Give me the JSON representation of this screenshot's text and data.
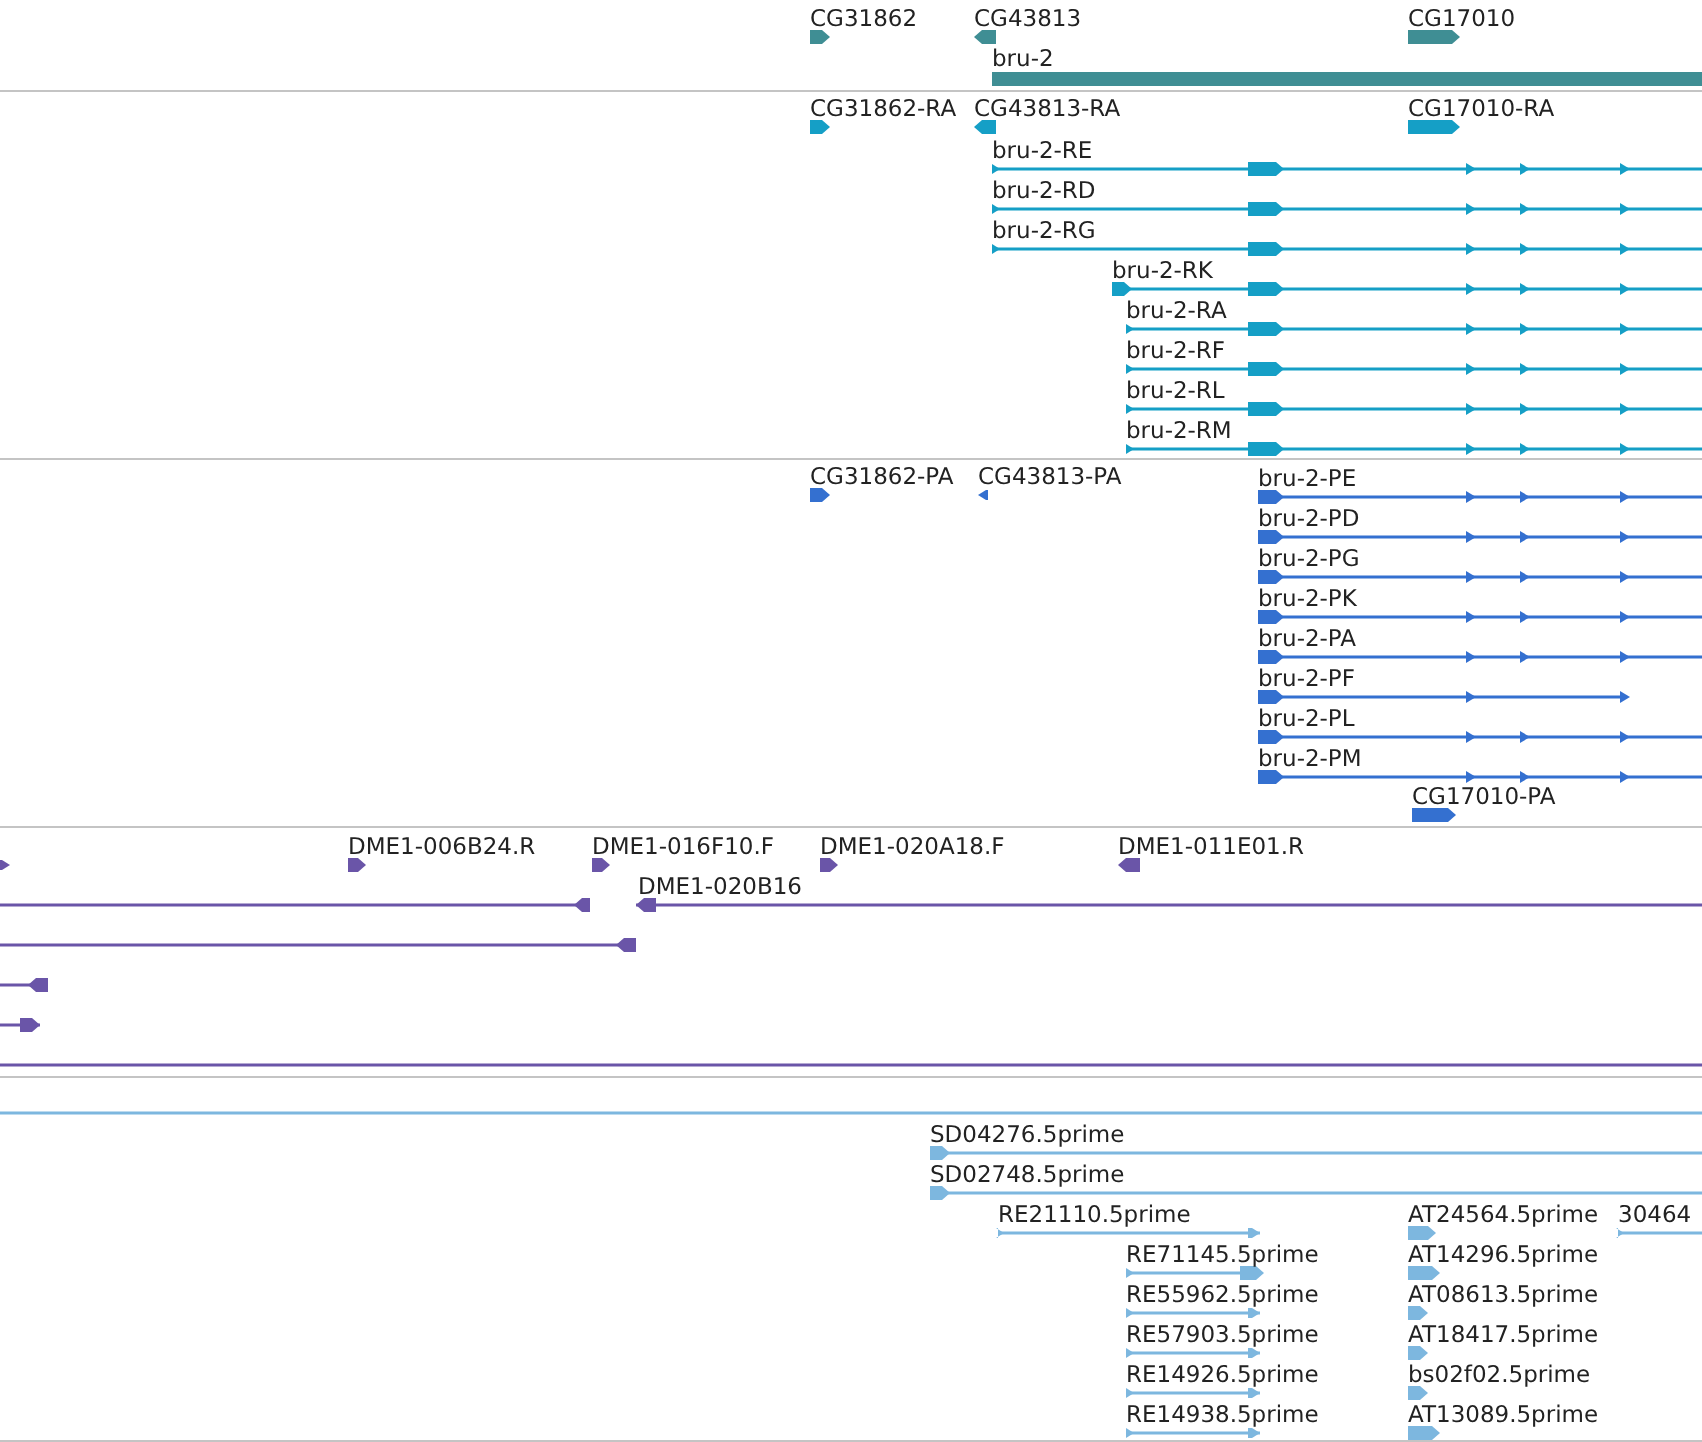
{
  "tracks": [
    {
      "color": "#3f8e94",
      "features": [
        {
          "label": "CG31862",
          "reverse": false
        },
        {
          "label": "CG43813",
          "reverse": true
        },
        {
          "label": "CG17010",
          "reverse": false
        },
        {
          "label": "bru-2",
          "reverse": false
        }
      ]
    },
    {
      "color": "#159fc6",
      "features": [
        {
          "label": "CG31862-RA",
          "reverse": false
        },
        {
          "label": "CG43813-RA",
          "reverse": true
        },
        {
          "label": "CG17010-RA",
          "reverse": false
        },
        {
          "label": "bru-2-RE",
          "reverse": false
        },
        {
          "label": "bru-2-RD",
          "reverse": false
        },
        {
          "label": "bru-2-RG",
          "reverse": false
        },
        {
          "label": "bru-2-RK",
          "reverse": false
        },
        {
          "label": "bru-2-RA",
          "reverse": false
        },
        {
          "label": "bru-2-RF",
          "reverse": false
        },
        {
          "label": "bru-2-RL",
          "reverse": false
        },
        {
          "label": "bru-2-RM",
          "reverse": false
        }
      ]
    },
    {
      "color": "#3470d0",
      "features": [
        {
          "label": "CG31862-PA",
          "reverse": false
        },
        {
          "label": "CG43813-PA",
          "reverse": true
        },
        {
          "label": "bru-2-PE",
          "reverse": false
        },
        {
          "label": "bru-2-PD",
          "reverse": false
        },
        {
          "label": "bru-2-PG",
          "reverse": false
        },
        {
          "label": "bru-2-PK",
          "reverse": false
        },
        {
          "label": "bru-2-PA",
          "reverse": false
        },
        {
          "label": "bru-2-PF",
          "reverse": false
        },
        {
          "label": "bru-2-PL",
          "reverse": false
        },
        {
          "label": "bru-2-PM",
          "reverse": false
        },
        {
          "label": "CG17010-PA",
          "reverse": false
        }
      ]
    },
    {
      "color": "#6a55a8",
      "features": [
        {
          "reverse": false
        },
        {
          "label": "DME1-006B24.R",
          "reverse": false
        },
        {
          "label": "DME1-016F10.F",
          "reverse": false
        },
        {
          "label": "DME1-020A18.F",
          "reverse": false
        },
        {
          "label": "DME1-011E01.R",
          "reverse": true
        },
        {
          "reverse": true
        },
        {
          "label": "DME1-020B16",
          "reverse": true
        },
        {
          "reverse": true
        },
        {
          "reverse": true
        },
        {
          "reverse": false
        }
      ]
    },
    {
      "color": "#7db7df",
      "features": [
        {
          "label": "SD04276.5prime",
          "reverse": false
        },
        {
          "label": "SD02748.5prime",
          "reverse": false
        },
        {
          "label": "RE21110.5prime",
          "reverse": false
        },
        {
          "label": "AT24564.5prime",
          "reverse": false
        },
        {
          "label": "30464",
          "reverse": false
        },
        {
          "label": "RE71145.5prime",
          "reverse": false
        },
        {
          "label": "AT14296.5prime",
          "reverse": false
        },
        {
          "label": "RE55962.5prime",
          "reverse": false
        },
        {
          "label": "AT08613.5prime",
          "reverse": false
        },
        {
          "label": "RE57903.5prime",
          "reverse": false
        },
        {
          "label": "AT18417.5prime",
          "reverse": false
        },
        {
          "label": "RE14926.5prime",
          "reverse": false
        },
        {
          "label": "bs02f02.5prime",
          "reverse": false
        },
        {
          "label": "RE14938.5prime",
          "reverse": false
        },
        {
          "label": "AT13089.5prime",
          "reverse": false
        }
      ]
    }
  ]
}
